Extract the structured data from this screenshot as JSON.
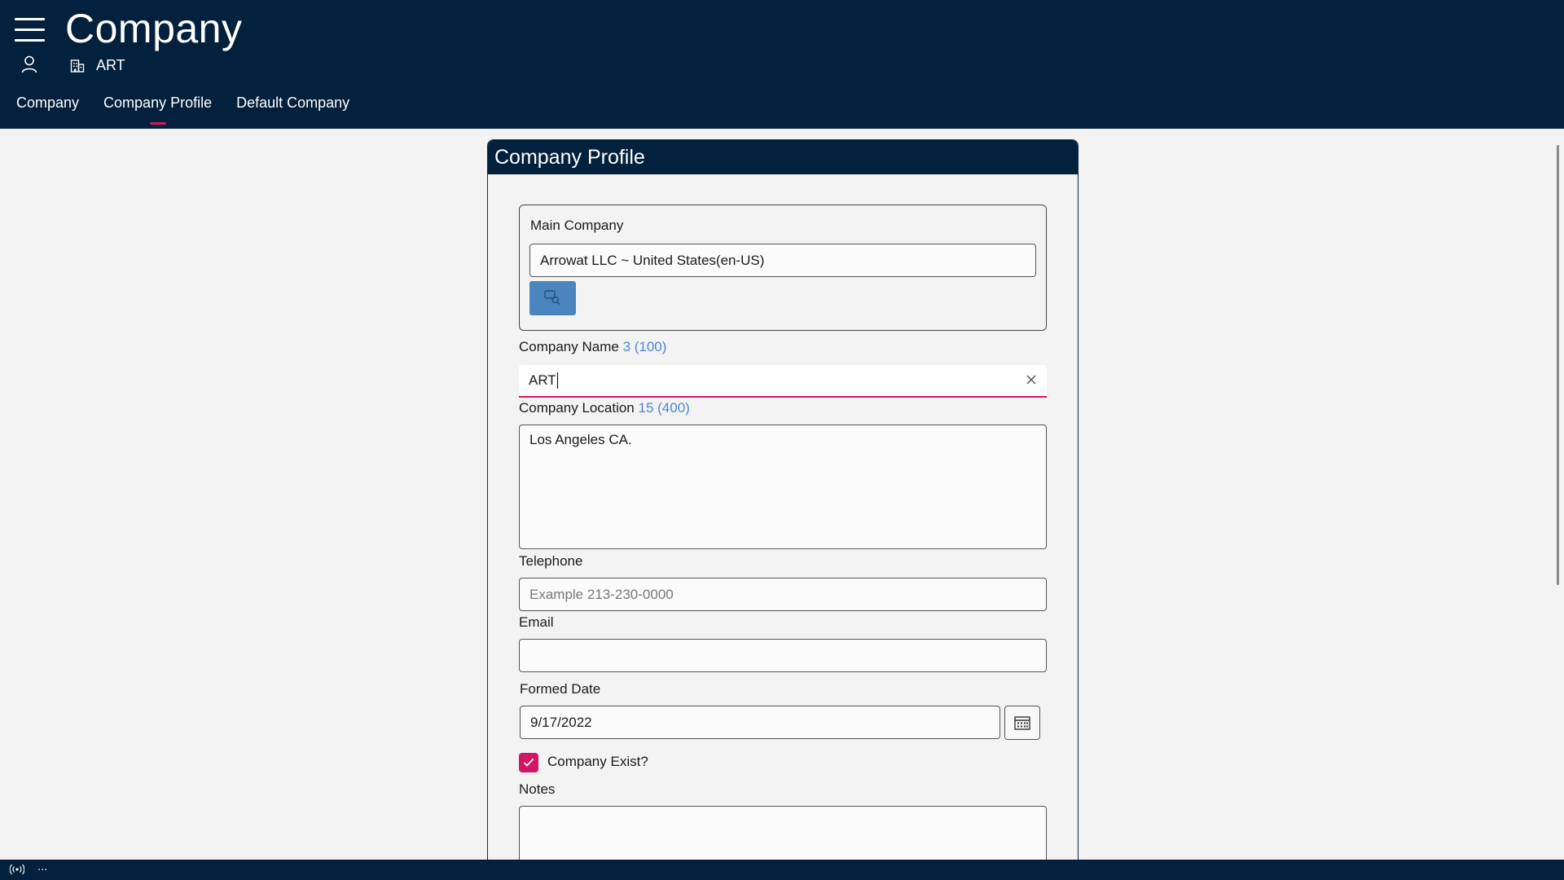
{
  "header": {
    "title": "Company",
    "company_code": "ART",
    "tabs": [
      {
        "label": "Company",
        "active": false
      },
      {
        "label": "Company Profile",
        "active": true
      },
      {
        "label": "Default Company",
        "active": false
      }
    ]
  },
  "card": {
    "title": "Company Profile",
    "main_company": {
      "label": "Main Company",
      "value": "Arrowat LLC ~ United States(en-US)"
    },
    "company_name": {
      "label": "Company Name",
      "counter": "3 (100)",
      "value": "ART"
    },
    "company_location": {
      "label": "Company Location",
      "counter": "15 (400)",
      "value": "Los Angeles CA."
    },
    "telephone": {
      "label": "Telephone",
      "value": "",
      "placeholder": "Example 213-230-0000"
    },
    "email": {
      "label": "Email",
      "value": ""
    },
    "formed_date": {
      "label": "Formed Date",
      "value": "9/17/2022"
    },
    "company_exist": {
      "label": "Company Exist?",
      "checked": true
    },
    "notes": {
      "label": "Notes",
      "value": ""
    }
  },
  "status_bar": {
    "text": "..."
  },
  "colors": {
    "header_bg": "#03203c",
    "accent": "#d31565",
    "button_blue": "#4a86bd",
    "counter_blue": "#4a86d9"
  }
}
